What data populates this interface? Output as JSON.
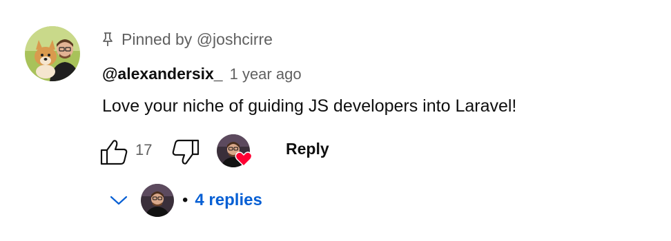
{
  "comment": {
    "pinned_label": "Pinned by @joshcirre",
    "author": "@alexandersix_",
    "timestamp": "1 year ago",
    "text": "Love your niche of guiding JS developers into Laravel!",
    "like_count": "17",
    "reply_label": "Reply",
    "replies_label": "4 replies"
  },
  "icons": {
    "pin": "pin-icon",
    "like": "thumbs-up-icon",
    "dislike": "thumbs-down-icon",
    "heart": "heart-icon",
    "chevron": "chevron-down-icon"
  },
  "colors": {
    "link_blue": "#065fd4",
    "heart_red": "#ff0033",
    "muted": "#606060"
  }
}
